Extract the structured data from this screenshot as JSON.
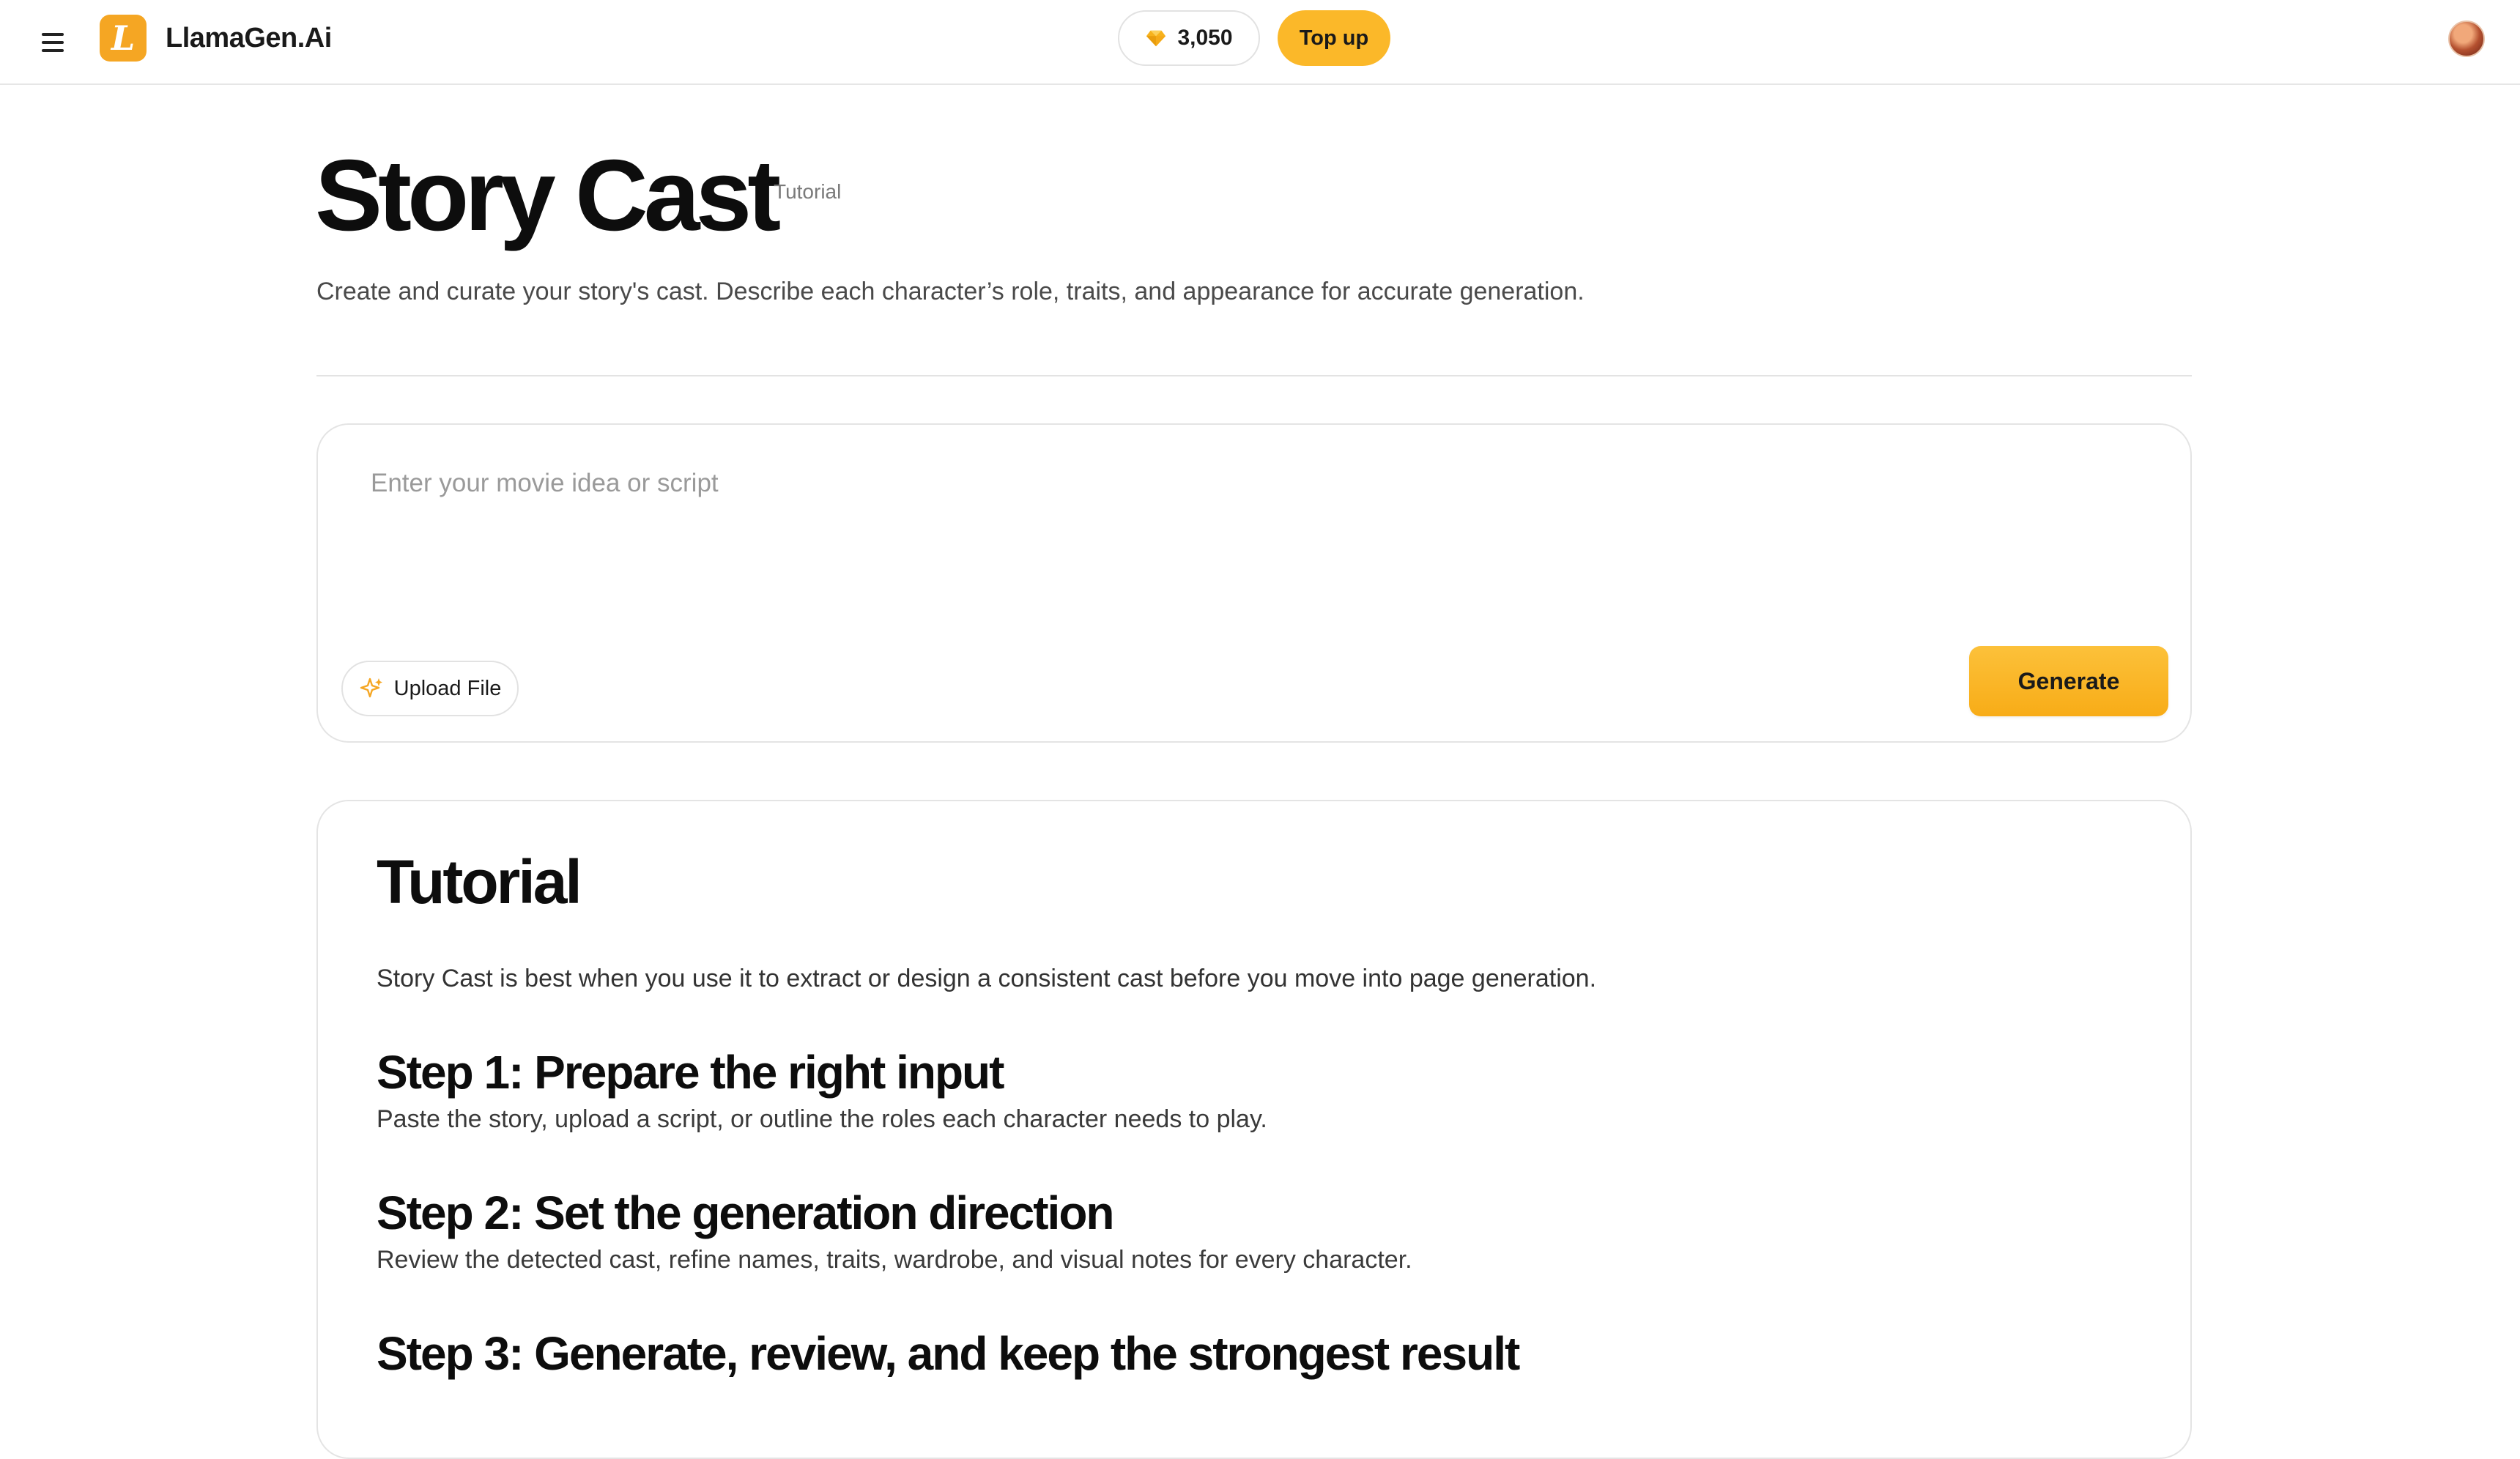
{
  "brand": {
    "name": "LlamaGen.Ai",
    "logo_glyph": "L"
  },
  "topbar": {
    "credits": "3,050",
    "topup_label": "Top up"
  },
  "header": {
    "title": "Story Cast",
    "tutorial_link": "Tutorial",
    "subtitle": "Create and curate your story's cast. Describe each character’s role, traits, and appearance for accurate generation."
  },
  "composer": {
    "placeholder": "Enter your movie idea or script",
    "value": "",
    "upload_label": "Upload File",
    "generate_label": "Generate"
  },
  "tutorial": {
    "title": "Tutorial",
    "intro": "Story Cast is best when you use it to extract or design a consistent cast before you move into page generation.",
    "steps": [
      {
        "heading": "Step 1: Prepare the right input",
        "desc": "Paste the story, upload a script, or outline the roles each character needs to play."
      },
      {
        "heading": "Step 2: Set the generation direction",
        "desc": "Review the detected cast, refine names, traits, wardrobe, and visual notes for every character."
      },
      {
        "heading": "Step 3: Generate, review, and keep the strongest result",
        "desc": ""
      }
    ]
  },
  "colors": {
    "accent": "#fbb829",
    "logo": "#f5a623",
    "border": "#e4e4e4",
    "text_muted": "#7a7a7a"
  },
  "icons": {
    "menu": "hamburger-menu-icon",
    "credits": "diamond-gem-icon",
    "upload": "sparkle-icon"
  }
}
